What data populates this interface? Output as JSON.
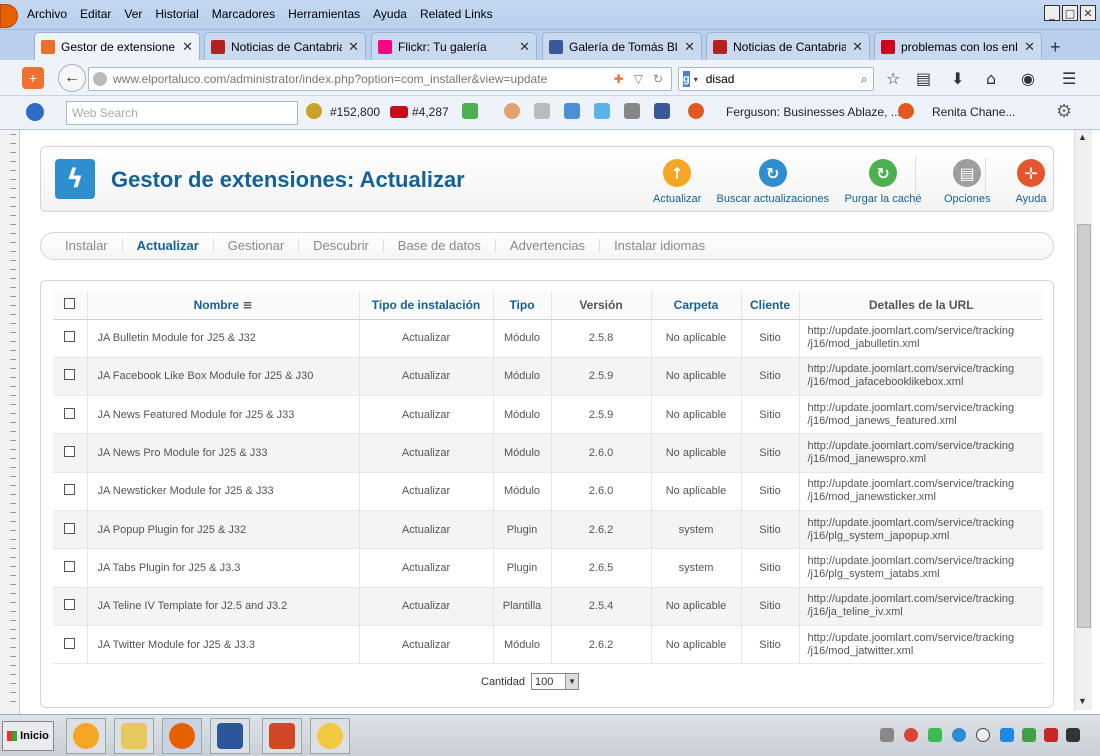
{
  "menubar": {
    "items": [
      "Archivo",
      "Editar",
      "Ver",
      "Historial",
      "Marcadores",
      "Herramientas",
      "Ayuda",
      "Related Links"
    ]
  },
  "tabs": [
    {
      "title": "Gestor de extensione...",
      "active": true,
      "favicon_color": "#e8702a"
    },
    {
      "title": "Noticias de Cantabria...",
      "active": false,
      "favicon_color": "#b22222"
    },
    {
      "title": "Flickr: Tu galería",
      "active": false,
      "favicon_color": "#ff0084"
    },
    {
      "title": "Galería de Tomás Bla...",
      "active": false,
      "favicon_color": "#3b5998"
    },
    {
      "title": "Noticias de Cantabria...",
      "active": false,
      "favicon_color": "#b22222"
    },
    {
      "title": "problemas con los enl...",
      "active": false,
      "favicon_color": "#d0021b"
    }
  ],
  "navbar": {
    "url": "www.elportaluco.com/administrator/index.php?option=com_installer&view=update",
    "search_value": "disad"
  },
  "toolbar2": {
    "search_placeholder": "Web Search",
    "count1": "#152,800",
    "count2": "#4,287",
    "bookmark1": "Ferguson: Businesses Ablaze, ...",
    "bookmark2": "Renita Chane..."
  },
  "header": {
    "title": "Gestor de extensiones: Actualizar",
    "buttons": [
      {
        "label": "Actualizar",
        "icon": "upload-icon",
        "color": "#f5a623"
      },
      {
        "label": "Buscar actualizaciones",
        "icon": "refresh-icon",
        "color": "#2d8ed0"
      },
      {
        "label": "Purgar la caché",
        "icon": "refresh-green-icon",
        "color": "#4caf50"
      },
      {
        "label": "Opciones",
        "icon": "options-icon",
        "color": "#9e9e9e"
      },
      {
        "label": "Ayuda",
        "icon": "lifebuoy-icon",
        "color": "#e4572e"
      }
    ]
  },
  "submenu": {
    "items": [
      "Instalar",
      "Actualizar",
      "Gestionar",
      "Descubrir",
      "Base de datos",
      "Advertencias",
      "Instalar idiomas"
    ],
    "active": "Actualizar"
  },
  "table": {
    "headers": {
      "name": "Nombre",
      "install_type": "Tipo de instalación",
      "type": "Tipo",
      "version": "Versión",
      "folder": "Carpeta",
      "client": "Cliente",
      "url": "Detalles de la URL"
    },
    "rows": [
      {
        "name": "JA Bulletin Module for J25 & J32",
        "install_type": "Actualizar",
        "type": "Módulo",
        "version": "2.5.8",
        "folder": "No aplicable",
        "client": "Sitio",
        "url1": "http://update.joomlart.com/service/tracking",
        "url2": "/j16/mod_jabulletin.xml"
      },
      {
        "name": "JA Facebook Like Box Module for J25 & J30",
        "install_type": "Actualizar",
        "type": "Módulo",
        "version": "2.5.9",
        "folder": "No aplicable",
        "client": "Sitio",
        "url1": "http://update.joomlart.com/service/tracking",
        "url2": "/j16/mod_jafacebooklikebox.xml"
      },
      {
        "name": "JA News Featured Module for J25 & J33",
        "install_type": "Actualizar",
        "type": "Módulo",
        "version": "2.5.9",
        "folder": "No aplicable",
        "client": "Sitio",
        "url1": "http://update.joomlart.com/service/tracking",
        "url2": "/j16/mod_janews_featured.xml"
      },
      {
        "name": "JA News Pro Module for J25 & J33",
        "install_type": "Actualizar",
        "type": "Módulo",
        "version": "2.6.0",
        "folder": "No aplicable",
        "client": "Sitio",
        "url1": "http://update.joomlart.com/service/tracking",
        "url2": "/j16/mod_janewspro.xml"
      },
      {
        "name": "JA Newsticker Module for J25 & J33",
        "install_type": "Actualizar",
        "type": "Módulo",
        "version": "2.6.0",
        "folder": "No aplicable",
        "client": "Sitio",
        "url1": "http://update.joomlart.com/service/tracking",
        "url2": "/j16/mod_janewsticker.xml"
      },
      {
        "name": "JA Popup Plugin for J25 & J32",
        "install_type": "Actualizar",
        "type": "Plugin",
        "version": "2.6.2",
        "folder": "system",
        "client": "Sitio",
        "url1": "http://update.joomlart.com/service/tracking",
        "url2": "/j16/plg_system_japopup.xml"
      },
      {
        "name": "JA Tabs Plugin for J25 & J3.3",
        "install_type": "Actualizar",
        "type": "Plugin",
        "version": "2.6.5",
        "folder": "system",
        "client": "Sitio",
        "url1": "http://update.joomlart.com/service/tracking",
        "url2": "/j16/plg_system_jatabs.xml"
      },
      {
        "name": "JA Teline IV Template for J2.5 and J3.2",
        "install_type": "Actualizar",
        "type": "Plantilla",
        "version": "2.5.4",
        "folder": "No aplicable",
        "client": "Sitio",
        "url1": "http://update.joomlart.com/service/tracking",
        "url2": "/j16/ja_teline_iv.xml"
      },
      {
        "name": "JA Twitter Module for J25 & J3.3",
        "install_type": "Actualizar",
        "type": "Módulo",
        "version": "2.6.2",
        "folder": "No aplicable",
        "client": "Sitio",
        "url1": "http://update.joomlart.com/service/tracking",
        "url2": "/j16/mod_jatwitter.xml"
      }
    ]
  },
  "pagination": {
    "label": "Cantidad",
    "value": "100"
  },
  "taskbar": {
    "start_label": "Inicio"
  }
}
